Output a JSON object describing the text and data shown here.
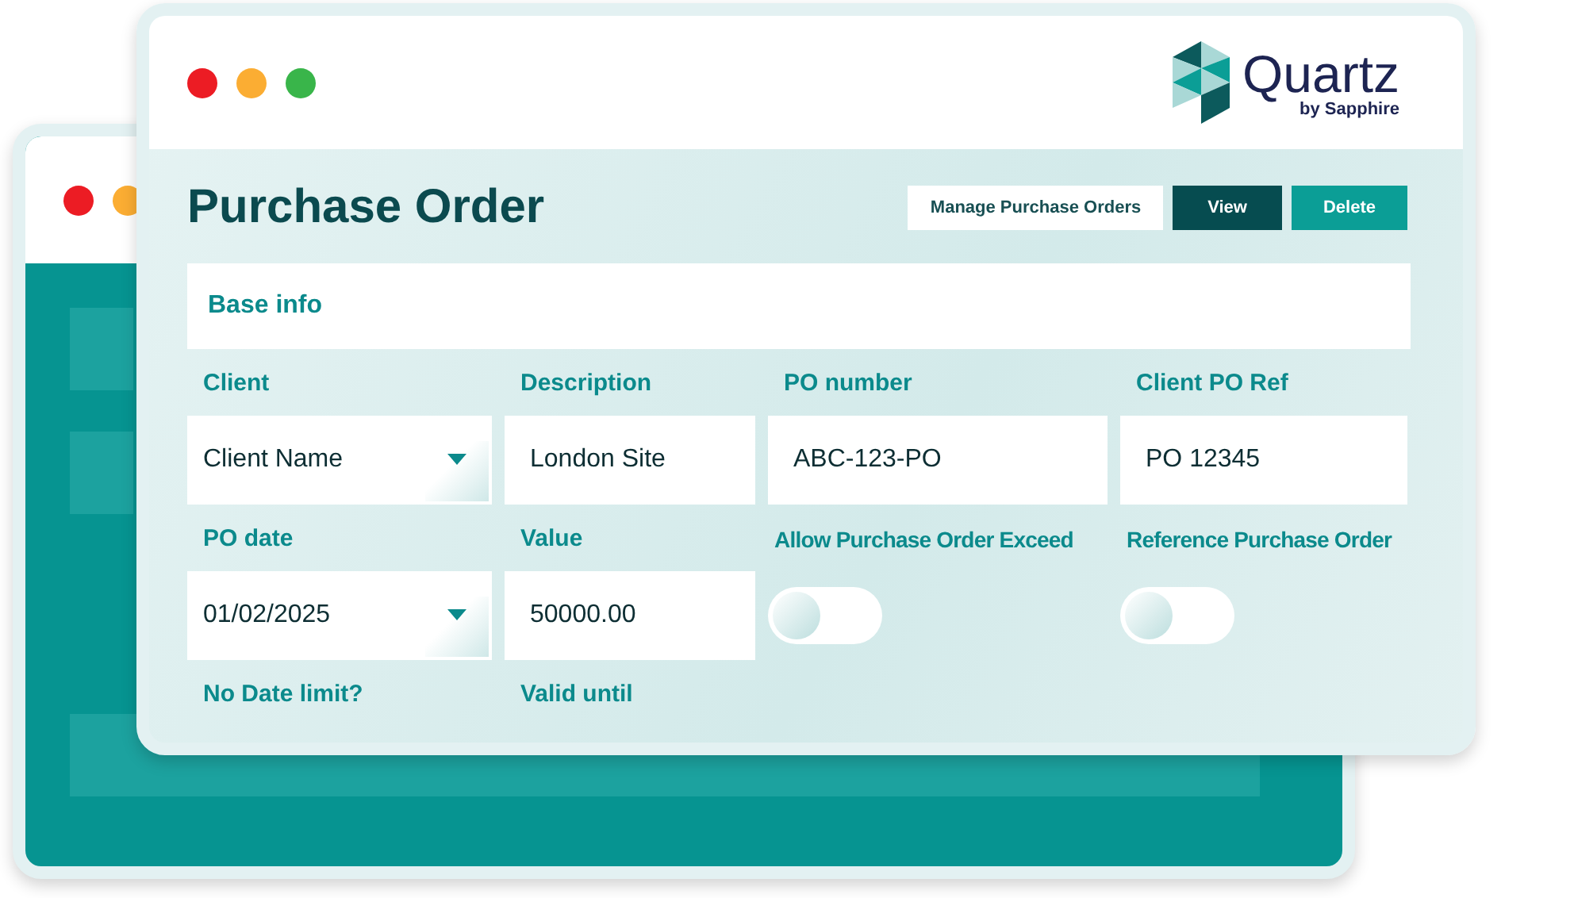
{
  "logo": {
    "name": "Quartz",
    "tagline": "by Sapphire"
  },
  "title": "Purchase Order",
  "buttons": [
    {
      "label": "Manage Purchase Orders",
      "kind": "outline"
    },
    {
      "label": "View",
      "kind": "dark"
    },
    {
      "label": "Delete",
      "kind": "teal"
    }
  ],
  "section": {
    "title": "Base info"
  },
  "fields": [
    {
      "label": "Client",
      "kind": "select",
      "value": "Client Name"
    },
    {
      "label": "Description",
      "kind": "text",
      "value": "London Site"
    },
    {
      "label": "PO number",
      "kind": "text",
      "value": "ABC-123-PO"
    },
    {
      "label": "Client PO Ref",
      "kind": "text",
      "value": "PO 12345"
    },
    {
      "label": "PO date",
      "kind": "select",
      "value": "01/02/2025"
    },
    {
      "label": "Value",
      "kind": "text",
      "value": "50000.00"
    },
    {
      "label": "Allow Purchase Order Exceed",
      "kind": "toggle",
      "on": false
    },
    {
      "label": "Reference Purchase Order",
      "kind": "toggle",
      "on": false
    },
    {
      "label": "No Date limit?",
      "kind": "label"
    },
    {
      "label": "Valid until",
      "kind": "label"
    }
  ]
}
